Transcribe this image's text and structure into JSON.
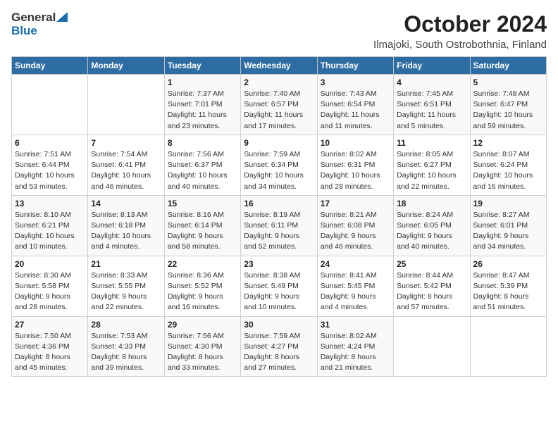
{
  "logo": {
    "general": "General",
    "blue": "Blue"
  },
  "title": "October 2024",
  "subtitle": "Ilmajoki, South Ostrobothnia, Finland",
  "headers": [
    "Sunday",
    "Monday",
    "Tuesday",
    "Wednesday",
    "Thursday",
    "Friday",
    "Saturday"
  ],
  "weeks": [
    [
      {
        "day": "",
        "detail": ""
      },
      {
        "day": "",
        "detail": ""
      },
      {
        "day": "1",
        "detail": "Sunrise: 7:37 AM\nSunset: 7:01 PM\nDaylight: 11 hours\nand 23 minutes."
      },
      {
        "day": "2",
        "detail": "Sunrise: 7:40 AM\nSunset: 6:57 PM\nDaylight: 11 hours\nand 17 minutes."
      },
      {
        "day": "3",
        "detail": "Sunrise: 7:43 AM\nSunset: 6:54 PM\nDaylight: 11 hours\nand 11 minutes."
      },
      {
        "day": "4",
        "detail": "Sunrise: 7:45 AM\nSunset: 6:51 PM\nDaylight: 11 hours\nand 5 minutes."
      },
      {
        "day": "5",
        "detail": "Sunrise: 7:48 AM\nSunset: 6:47 PM\nDaylight: 10 hours\nand 59 minutes."
      }
    ],
    [
      {
        "day": "6",
        "detail": "Sunrise: 7:51 AM\nSunset: 6:44 PM\nDaylight: 10 hours\nand 53 minutes."
      },
      {
        "day": "7",
        "detail": "Sunrise: 7:54 AM\nSunset: 6:41 PM\nDaylight: 10 hours\nand 46 minutes."
      },
      {
        "day": "8",
        "detail": "Sunrise: 7:56 AM\nSunset: 6:37 PM\nDaylight: 10 hours\nand 40 minutes."
      },
      {
        "day": "9",
        "detail": "Sunrise: 7:59 AM\nSunset: 6:34 PM\nDaylight: 10 hours\nand 34 minutes."
      },
      {
        "day": "10",
        "detail": "Sunrise: 8:02 AM\nSunset: 6:31 PM\nDaylight: 10 hours\nand 28 minutes."
      },
      {
        "day": "11",
        "detail": "Sunrise: 8:05 AM\nSunset: 6:27 PM\nDaylight: 10 hours\nand 22 minutes."
      },
      {
        "day": "12",
        "detail": "Sunrise: 8:07 AM\nSunset: 6:24 PM\nDaylight: 10 hours\nand 16 minutes."
      }
    ],
    [
      {
        "day": "13",
        "detail": "Sunrise: 8:10 AM\nSunset: 6:21 PM\nDaylight: 10 hours\nand 10 minutes."
      },
      {
        "day": "14",
        "detail": "Sunrise: 8:13 AM\nSunset: 6:18 PM\nDaylight: 10 hours\nand 4 minutes."
      },
      {
        "day": "15",
        "detail": "Sunrise: 8:16 AM\nSunset: 6:14 PM\nDaylight: 9 hours\nand 58 minutes."
      },
      {
        "day": "16",
        "detail": "Sunrise: 8:19 AM\nSunset: 6:11 PM\nDaylight: 9 hours\nand 52 minutes."
      },
      {
        "day": "17",
        "detail": "Sunrise: 8:21 AM\nSunset: 6:08 PM\nDaylight: 9 hours\nand 46 minutes."
      },
      {
        "day": "18",
        "detail": "Sunrise: 8:24 AM\nSunset: 6:05 PM\nDaylight: 9 hours\nand 40 minutes."
      },
      {
        "day": "19",
        "detail": "Sunrise: 8:27 AM\nSunset: 6:01 PM\nDaylight: 9 hours\nand 34 minutes."
      }
    ],
    [
      {
        "day": "20",
        "detail": "Sunrise: 8:30 AM\nSunset: 5:58 PM\nDaylight: 9 hours\nand 28 minutes."
      },
      {
        "day": "21",
        "detail": "Sunrise: 8:33 AM\nSunset: 5:55 PM\nDaylight: 9 hours\nand 22 minutes."
      },
      {
        "day": "22",
        "detail": "Sunrise: 8:36 AM\nSunset: 5:52 PM\nDaylight: 9 hours\nand 16 minutes."
      },
      {
        "day": "23",
        "detail": "Sunrise: 8:38 AM\nSunset: 5:49 PM\nDaylight: 9 hours\nand 10 minutes."
      },
      {
        "day": "24",
        "detail": "Sunrise: 8:41 AM\nSunset: 5:45 PM\nDaylight: 9 hours\nand 4 minutes."
      },
      {
        "day": "25",
        "detail": "Sunrise: 8:44 AM\nSunset: 5:42 PM\nDaylight: 8 hours\nand 57 minutes."
      },
      {
        "day": "26",
        "detail": "Sunrise: 8:47 AM\nSunset: 5:39 PM\nDaylight: 8 hours\nand 51 minutes."
      }
    ],
    [
      {
        "day": "27",
        "detail": "Sunrise: 7:50 AM\nSunset: 4:36 PM\nDaylight: 8 hours\nand 45 minutes."
      },
      {
        "day": "28",
        "detail": "Sunrise: 7:53 AM\nSunset: 4:33 PM\nDaylight: 8 hours\nand 39 minutes."
      },
      {
        "day": "29",
        "detail": "Sunrise: 7:56 AM\nSunset: 4:30 PM\nDaylight: 8 hours\nand 33 minutes."
      },
      {
        "day": "30",
        "detail": "Sunrise: 7:59 AM\nSunset: 4:27 PM\nDaylight: 8 hours\nand 27 minutes."
      },
      {
        "day": "31",
        "detail": "Sunrise: 8:02 AM\nSunset: 4:24 PM\nDaylight: 8 hours\nand 21 minutes."
      },
      {
        "day": "",
        "detail": ""
      },
      {
        "day": "",
        "detail": ""
      }
    ]
  ]
}
